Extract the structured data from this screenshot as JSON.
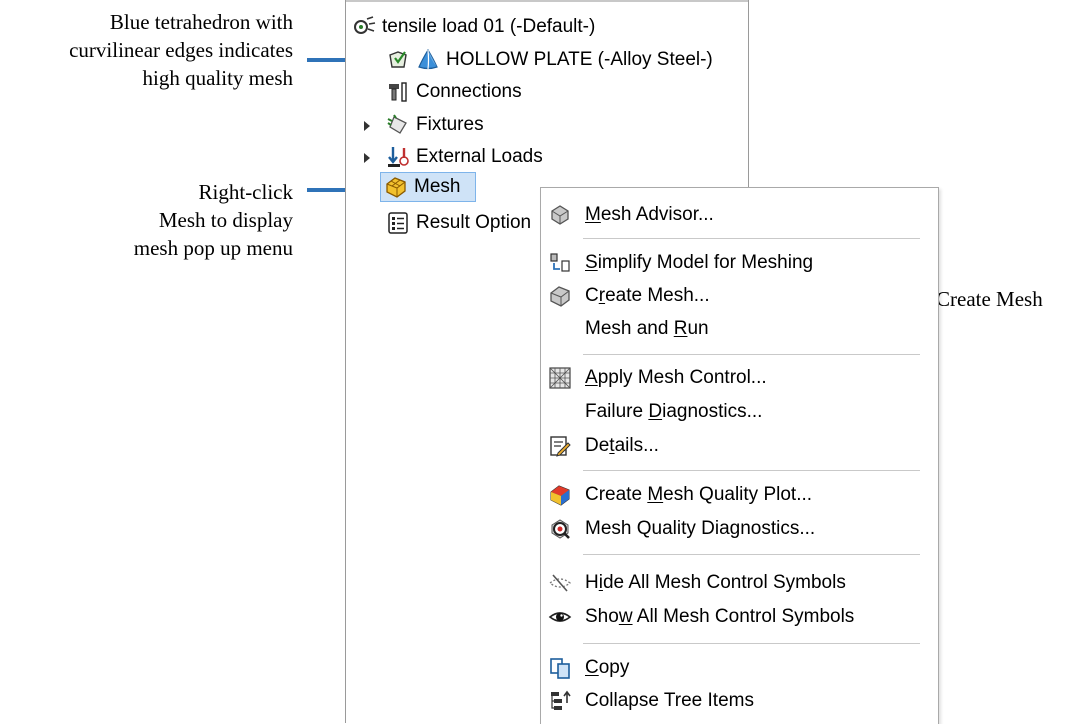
{
  "annotations": {
    "tetra_note": [
      "Blue tetrahedron with",
      "curvilinear edges indicates",
      "high quality mesh"
    ],
    "rightclick_note": [
      "Right-click",
      "Mesh to display",
      "mesh pop up menu"
    ],
    "create_mesh_note": "Create Mesh"
  },
  "tree": {
    "study": {
      "label": "tensile load 01 (-Default-)",
      "icon": "study-icon"
    },
    "part": {
      "label": "HOLLOW PLATE (-Alloy Steel-)",
      "icon": "tetrahedron-icon"
    },
    "connections": {
      "label": "Connections",
      "icon": "connections-icon"
    },
    "fixtures": {
      "label": "Fixtures",
      "icon": "fixtures-icon"
    },
    "external_loads": {
      "label": "External Loads",
      "icon": "external-loads-icon"
    },
    "mesh": {
      "label": "Mesh",
      "icon": "mesh-icon"
    },
    "result_options": {
      "label": "Result Option",
      "icon": "result-options-icon"
    }
  },
  "menu": {
    "items": [
      {
        "pre": "",
        "key": "M",
        "post": "esh Advisor...",
        "icon": "mesh-advisor-icon"
      },
      {
        "pre": "",
        "key": "S",
        "post": "implify Model for Meshing",
        "icon": "simplify-icon"
      },
      {
        "pre": "C",
        "key": "r",
        "post": "eate Mesh...",
        "icon": "create-mesh-icon"
      },
      {
        "pre": "Mesh and ",
        "key": "R",
        "post": "un",
        "icon": ""
      },
      {
        "pre": "",
        "key": "A",
        "post": "pply Mesh Control...",
        "icon": "mesh-control-icon"
      },
      {
        "pre": "Failure ",
        "key": "D",
        "post": "iagnostics...",
        "icon": ""
      },
      {
        "pre": "De",
        "key": "t",
        "post": "ails...",
        "icon": "details-icon"
      },
      {
        "pre": "Create ",
        "key": "M",
        "post": "esh Quality Plot...",
        "icon": "quality-plot-icon"
      },
      {
        "pre": "",
        "key": "",
        "post": "Mesh Quality Diagnostics...",
        "icon": "quality-diagnostics-icon"
      },
      {
        "pre": "H",
        "key": "i",
        "post": "de All Mesh Control Symbols",
        "icon": "hide-eye-icon"
      },
      {
        "pre": "Sho",
        "key": "w",
        "post": " All Mesh Control Symbols",
        "icon": "show-eye-icon"
      },
      {
        "pre": "",
        "key": "C",
        "post": "opy",
        "icon": "copy-icon"
      },
      {
        "pre": "",
        "key": "",
        "post": "Collapse Tree Items",
        "icon": "collapse-tree-icon"
      }
    ]
  },
  "colors": {
    "arrow": "#2f73b8",
    "selection_bg": "#cfe3f7",
    "selection_border": "#7eb4ea",
    "tetra_blue": "#3b8fd9",
    "mesh_yellow": "#f2c12e"
  }
}
